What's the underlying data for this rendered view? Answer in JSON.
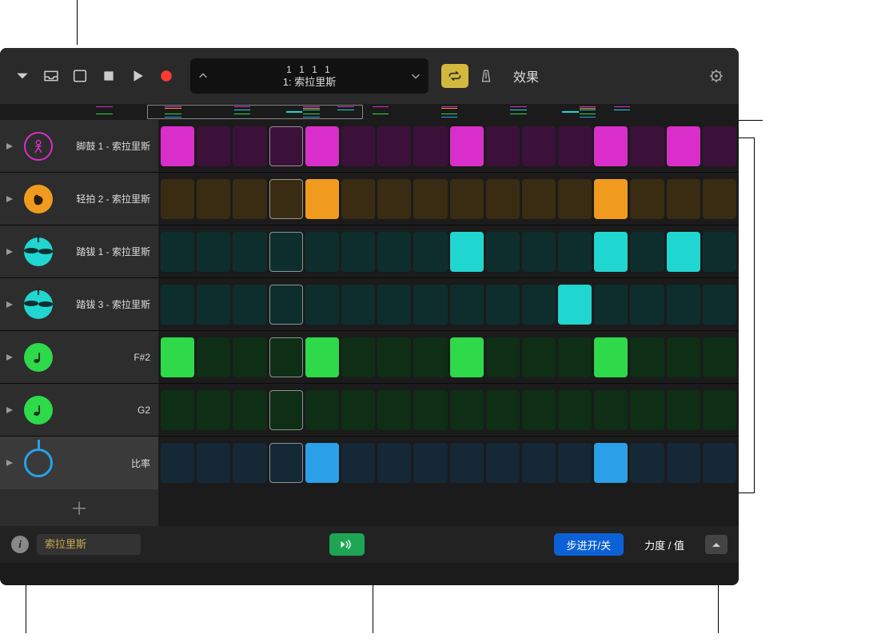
{
  "toolbar": {
    "position_display": "1  1  1       1",
    "pattern_label": "1: 索拉里斯",
    "fx_label": "效果"
  },
  "rows": [
    {
      "id": "kick",
      "label": "脚鼓 1 - 索拉里斯",
      "icon": "kick-icon",
      "on_color": "#d92ec9",
      "off_color": "#3c1139",
      "on_class": "magenta-on",
      "off_class": "magenta-off",
      "steps": [
        1,
        0,
        0,
        0,
        1,
        0,
        0,
        0,
        1,
        0,
        0,
        0,
        1,
        0,
        1,
        0
      ],
      "highlight_index": 3
    },
    {
      "id": "clap",
      "label": "轻拍 2 - 索拉里斯",
      "icon": "clap-icon",
      "on_color": "#f09b1e",
      "off_color": "#3a2c12",
      "on_class": "orange-on",
      "off_class": "orange-off",
      "steps": [
        0,
        0,
        0,
        0,
        1,
        0,
        0,
        0,
        0,
        0,
        0,
        0,
        1,
        0,
        0,
        0
      ],
      "highlight_index": 3
    },
    {
      "id": "hihat1",
      "label": "踏钹 1 - 索拉里斯",
      "icon": "hihat-icon",
      "on_color": "#20d6d0",
      "off_color": "#0e2e2e",
      "on_class": "cyan-on",
      "off_class": "cyan-off",
      "steps": [
        0,
        0,
        0,
        0,
        0,
        0,
        0,
        0,
        1,
        0,
        0,
        0,
        1,
        0,
        1,
        0
      ],
      "highlight_index": 3
    },
    {
      "id": "hihat3",
      "label": "踏钹 3 - 索拉里斯",
      "icon": "hihat-icon",
      "on_color": "#20d6d0",
      "off_color": "#0e2e2e",
      "on_class": "cyan-on",
      "off_class": "cyan-off",
      "steps": [
        0,
        0,
        0,
        0,
        0,
        0,
        0,
        0,
        0,
        0,
        0,
        1,
        0,
        0,
        0,
        0
      ],
      "highlight_index": 3
    },
    {
      "id": "note-fs2",
      "label": "F#2",
      "icon": "note-icon",
      "on_color": "#2ed94a",
      "off_color": "#0e2e16",
      "on_class": "green-on",
      "off_class": "green-off",
      "steps": [
        1,
        0,
        0,
        0,
        1,
        0,
        0,
        0,
        1,
        0,
        0,
        0,
        1,
        0,
        0,
        0
      ],
      "highlight_index": 3
    },
    {
      "id": "note-g2",
      "label": "G2",
      "icon": "note-icon",
      "on_color": "#2ed94a",
      "off_color": "#0e2e16",
      "on_class": "green-on",
      "off_class": "green-off",
      "steps": [
        0,
        0,
        0,
        0,
        0,
        0,
        0,
        0,
        0,
        0,
        0,
        0,
        0,
        0,
        0,
        0
      ],
      "highlight_index": 3
    },
    {
      "id": "rate",
      "label": "比率",
      "icon": "rate-icon",
      "on_color": "#2aa0e8",
      "off_color": "#142836",
      "on_class": "blue-on",
      "off_class": "blue-off",
      "steps": [
        0,
        0,
        0,
        0,
        1,
        0,
        0,
        0,
        0,
        0,
        0,
        0,
        1,
        0,
        0,
        0
      ],
      "highlight_index": 3,
      "selected": true
    }
  ],
  "bottom": {
    "patch_name": "索拉里斯",
    "mode_step": "步进开/关",
    "mode_velocity": "力度 / 值"
  },
  "colors": {
    "accent_yellow": "#d2b93e",
    "record": "#ff3b30",
    "preview_green": "#1da554",
    "active_blue": "#0d61d6"
  }
}
